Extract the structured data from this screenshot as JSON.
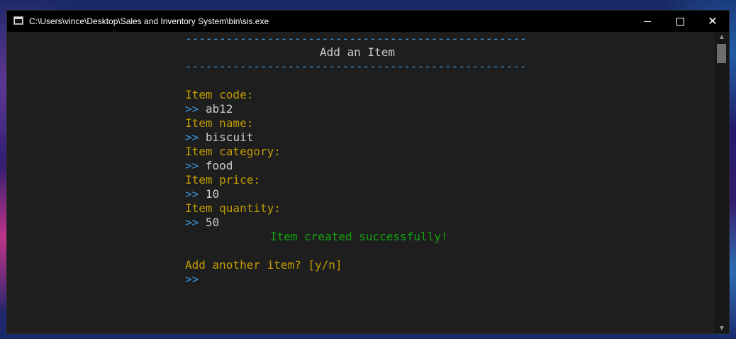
{
  "window": {
    "title": "C:\\Users\\vince\\Desktop\\Sales and Inventory System\\bin\\sis.exe",
    "controls": {
      "minimize_icon": "minimize-icon",
      "maximize_icon": "maximize-icon",
      "close_icon": "close-icon",
      "close_glyph": "✕"
    }
  },
  "console": {
    "separator": "--------------------------------------------------",
    "header": "Add an Item",
    "prompt": ">>",
    "fields": [
      {
        "label": "Item code:",
        "value": "ab12"
      },
      {
        "label": "Item name:",
        "value": "biscuit"
      },
      {
        "label": "Item category:",
        "value": "food"
      },
      {
        "label": "Item price:",
        "value": "10"
      },
      {
        "label": "Item quantity:",
        "value": "50"
      }
    ],
    "success_message": "Item created successfully!",
    "again_question": "Add another item? [y/n]"
  },
  "scrollbar": {
    "up_arrow": "▲",
    "down_arrow": "▼"
  },
  "colors": {
    "separator": "#3a96dd",
    "prompt": "#3a96dd",
    "label": "#c19c00",
    "value": "#cccccc",
    "success": "#13a10e",
    "console_background": "#1e1e1e",
    "titlebar_background": "#000000"
  }
}
